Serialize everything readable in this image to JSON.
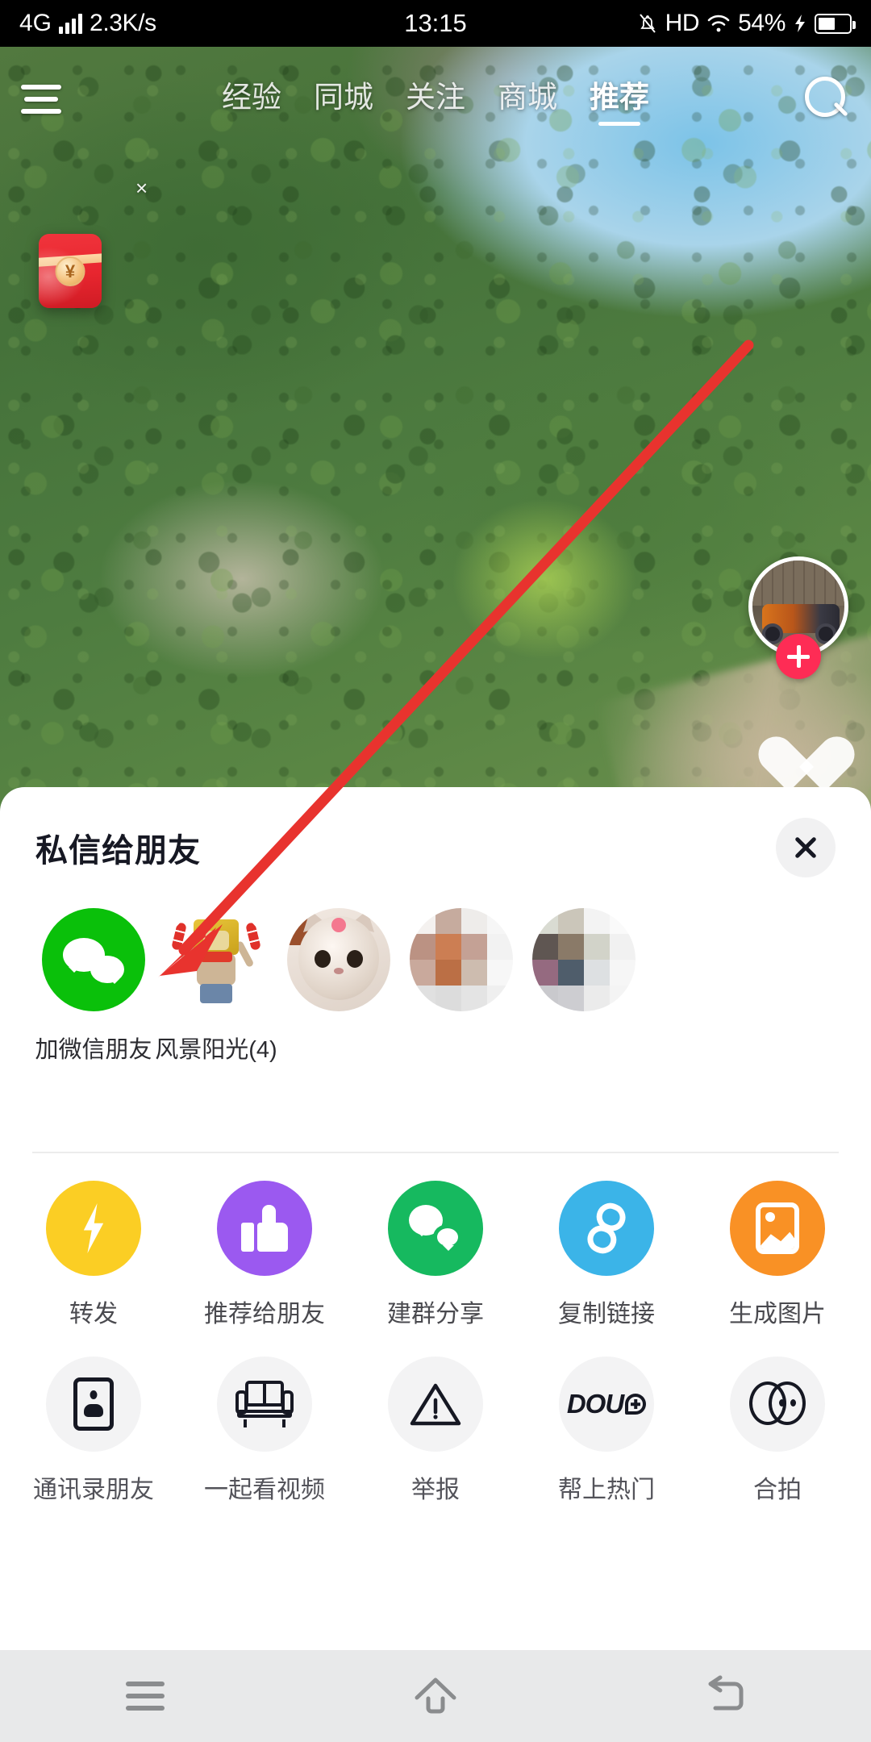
{
  "status_bar": {
    "network": "4G",
    "speed": "2.3K/s",
    "time": "13:15",
    "hd": "HD",
    "battery": "54%"
  },
  "top_nav": {
    "menu_icon": "hamburger-icon",
    "tabs": [
      {
        "label": "经验",
        "active": false
      },
      {
        "label": "同城",
        "active": false
      },
      {
        "label": "关注",
        "active": false
      },
      {
        "label": "商城",
        "active": false
      },
      {
        "label": "推荐",
        "active": true
      }
    ],
    "search_icon": "search-icon"
  },
  "video_overlay": {
    "red_packet_symbol": "¥",
    "red_packet_close": "×",
    "follow_plus": "+",
    "like_icon": "heart-icon"
  },
  "share_sheet": {
    "title": "私信给朋友",
    "close_label": "×",
    "contacts": [
      {
        "name": "加微信朋友",
        "avatar": "wechat-icon"
      },
      {
        "name": "风景阳光(4)",
        "avatar": "lion-mascot-avatar"
      },
      {
        "name": "",
        "avatar": "cat-avatar"
      },
      {
        "name": "",
        "avatar": "mosaic-avatar"
      },
      {
        "name": "",
        "avatar": "mosaic-avatar"
      }
    ],
    "actions_row1": [
      {
        "label": "转发",
        "icon": "lightning-icon",
        "color": "#FBCE24"
      },
      {
        "label": "推荐给朋友",
        "icon": "thumbs-up-icon",
        "color": "#9B59F0"
      },
      {
        "label": "建群分享",
        "icon": "group-chat-icon",
        "color": "#16B95F"
      },
      {
        "label": "复制链接",
        "icon": "link-icon",
        "color": "#3BB4E8"
      },
      {
        "label": "生成图片",
        "icon": "image-icon",
        "color": "#F99125"
      }
    ],
    "actions_row2": [
      {
        "label": "通讯录朋友",
        "icon": "contact-card-icon"
      },
      {
        "label": "一起看视频",
        "icon": "sofa-icon"
      },
      {
        "label": "举报",
        "icon": "warning-triangle-icon"
      },
      {
        "label": "帮上热门",
        "icon": "dou-plus-icon",
        "text": "DOU"
      },
      {
        "label": "合拍",
        "icon": "duet-icon"
      }
    ]
  },
  "nav_bar": {
    "menu": "menu-icon",
    "home": "home-icon",
    "back": "back-icon"
  }
}
